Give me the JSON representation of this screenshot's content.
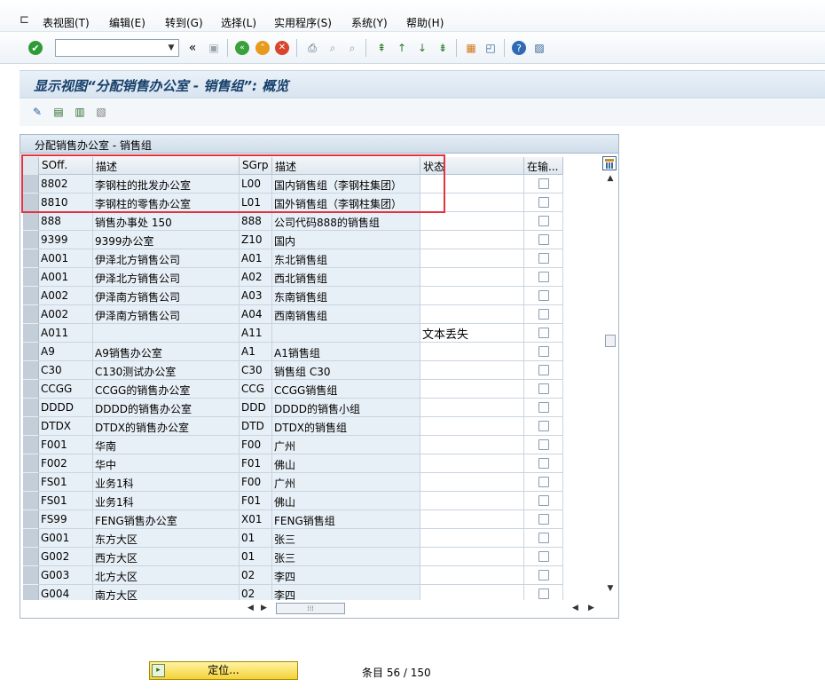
{
  "menubar": {
    "items": [
      "表视图(T)",
      "编辑(E)",
      "转到(G)",
      "选择(L)",
      "实用程序(S)",
      "系统(Y)",
      "帮助(H)"
    ]
  },
  "toolbar": {
    "command_field_value": "",
    "collapse_glyph": "«"
  },
  "page": {
    "title": "显示视图“分配销售办公室 - 销售组”: 概览"
  },
  "table": {
    "panel_title": "分配销售办公室 - 销售组",
    "columns": [
      "SOff.",
      "描述",
      "SGrp",
      "描述",
      "状态",
      "在输..."
    ],
    "rows": [
      {
        "soff": "8802",
        "desc1": "李钢柱的批发办公室",
        "sgrp": "L00",
        "desc2": "国内销售组（李钢柱集团）",
        "status": "",
        "checked": false
      },
      {
        "soff": "8810",
        "desc1": "李钢柱的零售办公室",
        "sgrp": "L01",
        "desc2": "国外销售组（李钢柱集团）",
        "status": "",
        "checked": false
      },
      {
        "soff": "888",
        "desc1": "销售办事处 150",
        "sgrp": "888",
        "desc2": "公司代码888的销售组",
        "status": "",
        "checked": false
      },
      {
        "soff": "9399",
        "desc1": "9399办公室",
        "sgrp": "Z10",
        "desc2": "国内",
        "status": "",
        "checked": false
      },
      {
        "soff": "A001",
        "desc1": "伊泽北方销售公司",
        "sgrp": "A01",
        "desc2": "东北销售组",
        "status": "",
        "checked": false
      },
      {
        "soff": "A001",
        "desc1": "伊泽北方销售公司",
        "sgrp": "A02",
        "desc2": "西北销售组",
        "status": "",
        "checked": false
      },
      {
        "soff": "A002",
        "desc1": "伊泽南方销售公司",
        "sgrp": "A03",
        "desc2": "东南销售组",
        "status": "",
        "checked": false
      },
      {
        "soff": "A002",
        "desc1": "伊泽南方销售公司",
        "sgrp": "A04",
        "desc2": "西南销售组",
        "status": "",
        "checked": false
      },
      {
        "soff": "A011",
        "desc1": "",
        "sgrp": "A11",
        "desc2": "",
        "status": "文本丢失",
        "checked": false
      },
      {
        "soff": "A9",
        "desc1": "A9销售办公室",
        "sgrp": "A1",
        "desc2": "A1销售组",
        "status": "",
        "checked": false
      },
      {
        "soff": "C30",
        "desc1": "C130测试办公室",
        "sgrp": "C30",
        "desc2": "销售组 C30",
        "status": "",
        "checked": false
      },
      {
        "soff": "CCGG",
        "desc1": "CCGG的销售办公室",
        "sgrp": "CCG",
        "desc2": "CCGG销售组",
        "status": "",
        "checked": false
      },
      {
        "soff": "DDDD",
        "desc1": "DDDD的销售办公室",
        "sgrp": "DDD",
        "desc2": "DDDD的销售小组",
        "status": "",
        "checked": false
      },
      {
        "soff": "DTDX",
        "desc1": "DTDX的销售办公室",
        "sgrp": "DTD",
        "desc2": "DTDX的销售组",
        "status": "",
        "checked": false
      },
      {
        "soff": "F001",
        "desc1": "华南",
        "sgrp": "F00",
        "desc2": "广州",
        "status": "",
        "checked": false
      },
      {
        "soff": "F002",
        "desc1": "华中",
        "sgrp": "F01",
        "desc2": "佛山",
        "status": "",
        "checked": false
      },
      {
        "soff": "FS01",
        "desc1": "业务1科",
        "sgrp": "F00",
        "desc2": "广州",
        "status": "",
        "checked": false
      },
      {
        "soff": "FS01",
        "desc1": "业务1科",
        "sgrp": "F01",
        "desc2": "佛山",
        "status": "",
        "checked": false
      },
      {
        "soff": "FS99",
        "desc1": "FENG销售办公室",
        "sgrp": "X01",
        "desc2": "FENG销售组",
        "status": "",
        "checked": false
      },
      {
        "soff": "G001",
        "desc1": "东方大区",
        "sgrp": "01",
        "desc2": "张三",
        "status": "",
        "checked": false
      },
      {
        "soff": "G002",
        "desc1": "西方大区",
        "sgrp": "01",
        "desc2": "张三",
        "status": "",
        "checked": false
      },
      {
        "soff": "G003",
        "desc1": "北方大区",
        "sgrp": "02",
        "desc2": "李四",
        "status": "",
        "checked": false
      },
      {
        "soff": "G004",
        "desc1": "南方大区",
        "sgrp": "02",
        "desc2": "李四",
        "status": "",
        "checked": false
      }
    ]
  },
  "footer": {
    "locate_label": "定位...",
    "entries_text": "条目 56 / 150"
  },
  "colors": {
    "highlight_border": "#e33340",
    "title_text": "#17406b",
    "cell_background": "#e8f0f7"
  }
}
